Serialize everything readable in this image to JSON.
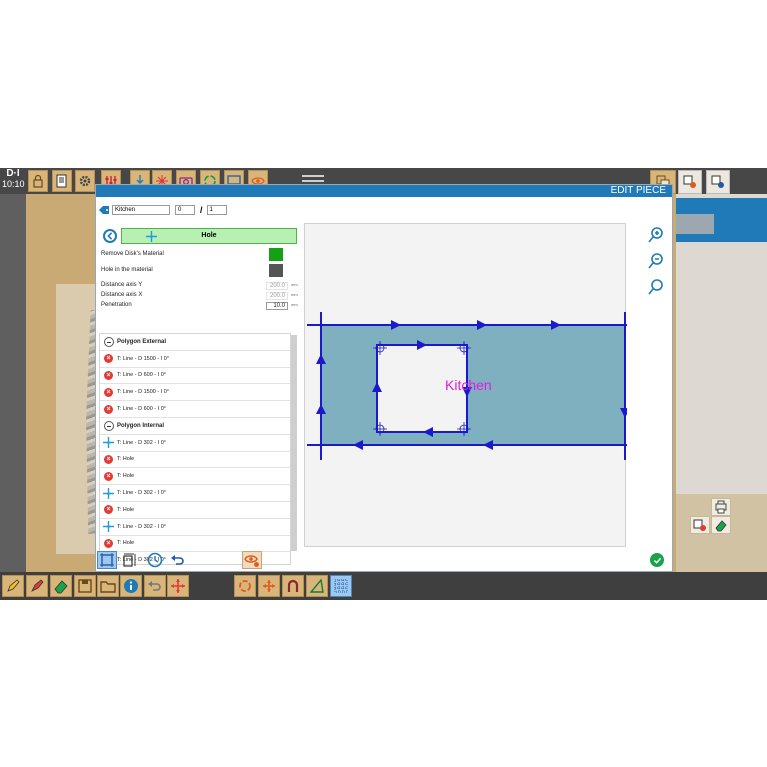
{
  "clock": "10:10",
  "dialog": {
    "title": "EDIT PIECE",
    "piece_name": "Kitchen",
    "piece_index": "0",
    "piece_total": "1",
    "selected_tool": "Hole",
    "properties": {
      "remove_disk_label": "Remove Disk's Material",
      "hole_in_material_label": "Hole in the material",
      "distance_y_label": "Distance axis Y",
      "distance_y_value": "200.0",
      "distance_x_label": "Distance axis X",
      "distance_x_value": "200.0",
      "penetration_label": "Penetration",
      "penetration_value": "10.0",
      "unit": "mm",
      "remove_disk_color": "#13a213",
      "hole_color": "#555555"
    },
    "tree": [
      {
        "type": "group",
        "label": "Polygon External"
      },
      {
        "type": "line",
        "label": "T: Line - D 1500 - I 0°"
      },
      {
        "type": "line",
        "label": "T: Line - D 600 - I 0°"
      },
      {
        "type": "line",
        "label": "T: Line - D 1500 - I 0°"
      },
      {
        "type": "line",
        "label": "T: Line - D 600 - I 0°"
      },
      {
        "type": "group",
        "label": "Polygon Internal"
      },
      {
        "type": "cross",
        "label": "T: Line - D 302 - I 0°"
      },
      {
        "type": "line",
        "label": "T: Hole"
      },
      {
        "type": "line",
        "label": "T: Hole"
      },
      {
        "type": "cross",
        "label": "T: Line - D 302 - I 0°"
      },
      {
        "type": "line",
        "label": "T: Hole"
      },
      {
        "type": "cross",
        "label": "T: Line - D 302 - I 0°"
      },
      {
        "type": "line",
        "label": "T: Hole"
      },
      {
        "type": "cross",
        "label": "T: Line - D 302 - I 0°"
      }
    ],
    "canvas_label": "Kitchen",
    "colors": {
      "accent": "#1f7ab7",
      "piece_fill": "#7fb0bf",
      "outline": "#1a1acc",
      "label": "#e21be0"
    }
  },
  "icons": {
    "top": [
      "lock-icon",
      "report-icon",
      "gear-icon",
      "sliders-icon",
      "pointer-icon",
      "laser-icon",
      "camera-icon",
      "recycle-icon",
      "monitor-icon",
      "eye-icon"
    ],
    "bottom": [
      "pencil-icon",
      "brush-icon",
      "eraser-icon",
      "save-icon",
      "folder-icon",
      "info-icon",
      "undo-icon",
      "move-icon",
      "rotate-icon",
      "arrows-icon",
      "magnet-icon",
      "angle-icon",
      "grid-icon"
    ]
  }
}
